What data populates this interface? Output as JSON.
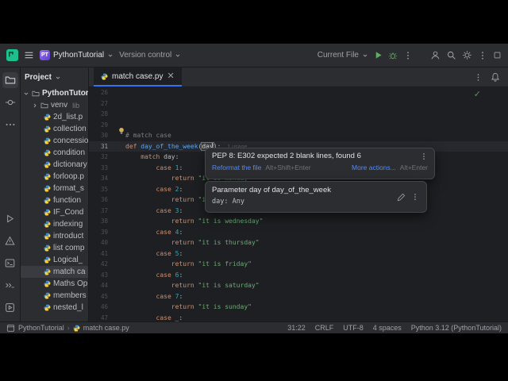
{
  "colors": {
    "accent_blue": "#3574F0",
    "link_blue": "#548AF7",
    "run_green": "#5FAD65",
    "keyword_orange": "#CF8E6D",
    "string_green": "#6AAB73",
    "number_teal": "#2AACB8",
    "function_blue": "#56A8F5",
    "comment_gray": "#7A7E85",
    "selection_bg": "#393B40"
  },
  "title_bar": {
    "project_avatar": "PT",
    "project_name": "PythonTutorial",
    "version_control_label": "Version control",
    "run_config_label": "Current File"
  },
  "project_panel": {
    "header_label": "Project",
    "root_label": "PythonTutorial",
    "venv_label": "venv",
    "venv_hint": "lib",
    "files": [
      "2d_list.p",
      "collection",
      "concessio",
      "condition",
      "dictionary",
      "forloop.p",
      "format_s",
      "function",
      "IF_Cond",
      "indexing",
      "introduct",
      "list comp",
      "Logical_",
      "match ca",
      "Maths Op",
      "members",
      "nested_l"
    ],
    "selected_index": 13
  },
  "editor": {
    "tab_label": "match case.py",
    "current_line": 31,
    "lines": [
      {
        "n": 26,
        "t": []
      },
      {
        "n": 27,
        "t": []
      },
      {
        "n": 28,
        "t": []
      },
      {
        "n": 29,
        "t": []
      },
      {
        "n": 30,
        "t": [
          [
            "c",
            "# match case"
          ]
        ]
      },
      {
        "n": 31,
        "t": [
          [
            "k",
            "def"
          ],
          [
            "p",
            " "
          ],
          [
            "f",
            "day_of_the_week"
          ],
          [
            "p",
            "("
          ],
          [
            "hl",
            "day"
          ],
          [
            "p",
            "):"
          ]
        ],
        "inlay": "1 usage"
      },
      {
        "n": 32,
        "t": [
          [
            "p",
            "    "
          ],
          [
            "k",
            "match"
          ],
          [
            "p",
            " day:"
          ]
        ]
      },
      {
        "n": 33,
        "t": [
          [
            "p",
            "        "
          ],
          [
            "k",
            "case "
          ],
          [
            "n",
            "1"
          ],
          [
            "p",
            ":"
          ]
        ]
      },
      {
        "n": 34,
        "t": [
          [
            "p",
            "            "
          ],
          [
            "k",
            "return "
          ],
          [
            "s",
            "\"it is monday\""
          ]
        ]
      },
      {
        "n": 35,
        "t": [
          [
            "p",
            "        "
          ],
          [
            "k",
            "case "
          ],
          [
            "n",
            "2"
          ],
          [
            "p",
            ":"
          ]
        ]
      },
      {
        "n": 36,
        "t": [
          [
            "p",
            "            "
          ],
          [
            "k",
            "return "
          ],
          [
            "s",
            "\"it is tuesday\""
          ]
        ]
      },
      {
        "n": 37,
        "t": [
          [
            "p",
            "        "
          ],
          [
            "k",
            "case "
          ],
          [
            "n",
            "3"
          ],
          [
            "p",
            ":"
          ]
        ]
      },
      {
        "n": 38,
        "t": [
          [
            "p",
            "            "
          ],
          [
            "k",
            "return "
          ],
          [
            "s",
            "\"it is wednesday\""
          ]
        ]
      },
      {
        "n": 39,
        "t": [
          [
            "p",
            "        "
          ],
          [
            "k",
            "case "
          ],
          [
            "n",
            "4"
          ],
          [
            "p",
            ":"
          ]
        ]
      },
      {
        "n": 40,
        "t": [
          [
            "p",
            "            "
          ],
          [
            "k",
            "return "
          ],
          [
            "s",
            "\"it is thursday\""
          ]
        ]
      },
      {
        "n": 41,
        "t": [
          [
            "p",
            "        "
          ],
          [
            "k",
            "case "
          ],
          [
            "n",
            "5"
          ],
          [
            "p",
            ":"
          ]
        ]
      },
      {
        "n": 42,
        "t": [
          [
            "p",
            "            "
          ],
          [
            "k",
            "return "
          ],
          [
            "s",
            "\"it is friday\""
          ]
        ]
      },
      {
        "n": 43,
        "t": [
          [
            "p",
            "        "
          ],
          [
            "k",
            "case "
          ],
          [
            "n",
            "6"
          ],
          [
            "p",
            ":"
          ]
        ]
      },
      {
        "n": 44,
        "t": [
          [
            "p",
            "            "
          ],
          [
            "k",
            "return "
          ],
          [
            "s",
            "\"it is saturday\""
          ]
        ]
      },
      {
        "n": 45,
        "t": [
          [
            "p",
            "        "
          ],
          [
            "k",
            "case "
          ],
          [
            "n",
            "7"
          ],
          [
            "p",
            ":"
          ]
        ]
      },
      {
        "n": 46,
        "t": [
          [
            "p",
            "            "
          ],
          [
            "k",
            "return "
          ],
          [
            "s",
            "\"it is sunday\""
          ]
        ]
      },
      {
        "n": 47,
        "t": [
          [
            "p",
            "        "
          ],
          [
            "k",
            "case"
          ],
          [
            "p",
            " _:"
          ]
        ]
      }
    ]
  },
  "popups": {
    "pep8": {
      "title": "PEP 8: E302 expected 2 blank lines, found 6",
      "reformat_label": "Reformat the file",
      "reformat_shortcut": "Alt+Shift+Enter",
      "more_label": "More actions...",
      "more_shortcut": "Alt+Enter"
    },
    "param": {
      "title": "Parameter day of day_of_the_week",
      "signature": "day: Any"
    }
  },
  "status_bar": {
    "breadcrumb_project": "PythonTutorial",
    "breadcrumb_file": "match case.py",
    "items": [
      "31:22",
      "CRLF",
      "UTF-8",
      "4 spaces",
      "Python 3.12 (PythonTutorial)"
    ]
  },
  "icons": {
    "pycharm-logo-icon": "teal rounded square",
    "main-menu-icon": "hamburger",
    "chevron-down-icon": "v",
    "run-icon": "green play triangle",
    "debug-icon": "green bug",
    "more-vertical-icon": "kebab dots",
    "user-icon": "profile silhouette",
    "search-icon": "magnifier",
    "settings-icon": "gear",
    "maximize-icon": "square outline",
    "notifications-icon": "bell",
    "project-icon": "folder",
    "commit-icon": "circle with lines",
    "more-icon": "horizontal dots",
    "problems-icon": "warning triangle",
    "terminal-icon": "terminal window",
    "python-console-icon": "chevrons prompt",
    "services-icon": "box with play",
    "python-file-icon": "blue yellow python glyph",
    "edit-icon": "pencil",
    "inspections-ok-icon": "green check",
    "intention-bulb-icon": "yellow lightbulb",
    "close-icon": "x"
  }
}
